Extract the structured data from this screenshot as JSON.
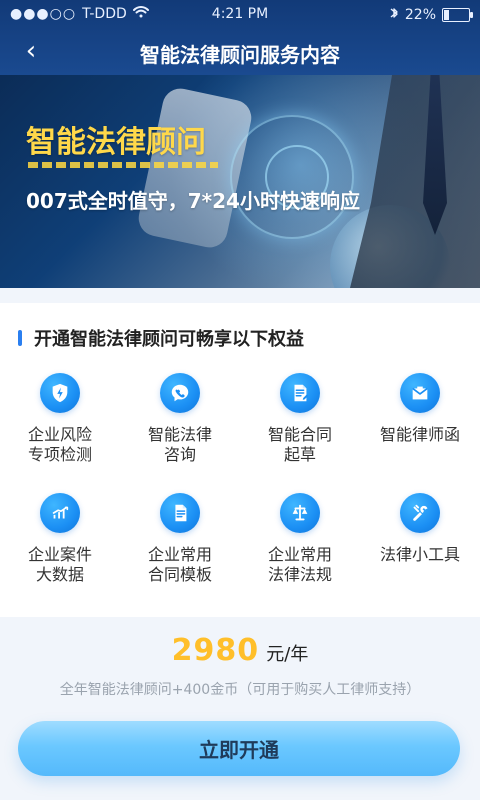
{
  "status": {
    "carrier": "T-DDD",
    "time": "4:21 PM",
    "battery": "22%",
    "icons": [
      "signal-dots-icon",
      "wifi-icon",
      "bluetooth-icon",
      "battery-icon"
    ]
  },
  "nav": {
    "back_icon": "back-chevron-icon",
    "title": "智能法律顾问服务内容"
  },
  "banner": {
    "title": "智能法律顾问",
    "subtitle": "007式全时值守，7*24小时快速响应"
  },
  "benefits": {
    "heading": "开通智能法律顾问可畅享以下权益",
    "items": [
      {
        "icon": "shield-lightning-icon",
        "label": "企业风险\n专项检测"
      },
      {
        "icon": "phone-chat-icon",
        "label": "智能法律\n咨询"
      },
      {
        "icon": "document-edit-icon",
        "label": "智能合同\n起草"
      },
      {
        "icon": "mail-envelope-icon",
        "label": "智能律师函"
      },
      {
        "icon": "chart-trend-icon",
        "label": "企业案件\n大数据"
      },
      {
        "icon": "contract-template-icon",
        "label": "企业常用\n合同模板"
      },
      {
        "icon": "scales-law-icon",
        "label": "企业常用\n法律法规"
      },
      {
        "icon": "tools-wrench-icon",
        "label": "法律小工具"
      }
    ]
  },
  "pricing": {
    "amount": "2980",
    "unit": "元/年",
    "description": "全年智能法律顾问+400金币（可用于购买人工律师支持）"
  },
  "cta": {
    "label": "立即开通"
  },
  "colors": {
    "header_blue": "#1a4a90",
    "accent_blue": "#2a7ff0",
    "price_yellow": "#ffbf2a",
    "banner_title_yellow": "#ffd84a",
    "cta_blue": "#6bc8ff"
  }
}
